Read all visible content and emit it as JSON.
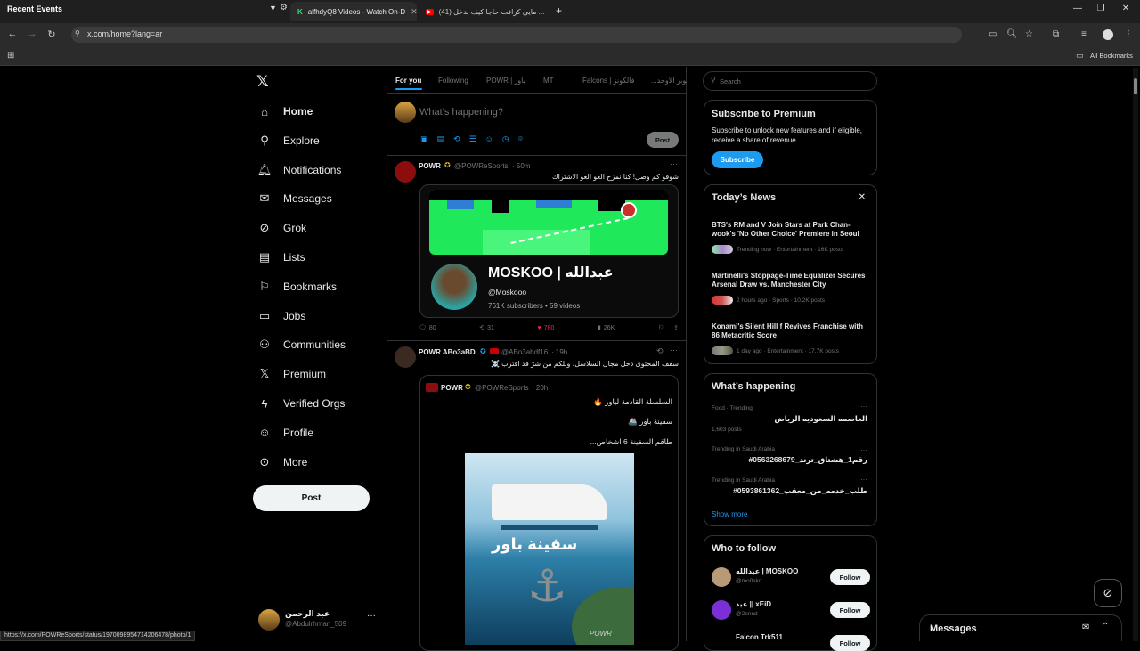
{
  "browser": {
    "window_label": "Recent Events",
    "tabs": [
      {
        "title": "alfhdyQ8 Videos - Watch On-D",
        "active": true
      },
      {
        "title": "(41) مايي كرافت حاجا كيف ندخل ...",
        "active": false
      }
    ],
    "url": "x.com/home?lang=ar",
    "all_bookmarks": "All Bookmarks",
    "status_url": "https://x.com/POWReSports/status/1970098954714206478/photo/1"
  },
  "sidebar": {
    "items": [
      {
        "label": "Home",
        "icon": "home-icon"
      },
      {
        "label": "Explore",
        "icon": "search-icon"
      },
      {
        "label": "Notifications",
        "icon": "bell-icon"
      },
      {
        "label": "Messages",
        "icon": "mail-icon"
      },
      {
        "label": "Grok",
        "icon": "grok-icon"
      },
      {
        "label": "Lists",
        "icon": "list-icon"
      },
      {
        "label": "Bookmarks",
        "icon": "bookmark-icon"
      },
      {
        "label": "Jobs",
        "icon": "briefcase-icon"
      },
      {
        "label": "Communities",
        "icon": "people-icon"
      },
      {
        "label": "Premium",
        "icon": "x-logo-icon"
      },
      {
        "label": "Verified Orgs",
        "icon": "lightning-icon"
      },
      {
        "label": "Profile",
        "icon": "person-icon"
      },
      {
        "label": "More",
        "icon": "more-circle-icon"
      }
    ],
    "post_label": "Post",
    "account_name": "عبد الرحمن",
    "account_handle": "@Abdulrhman_509"
  },
  "feed": {
    "tabs": [
      "For you",
      "Following",
      "POWR | باور",
      "MT",
      "Falcons | فالكونز",
      "...بوبر الأوحد"
    ],
    "compose_placeholder": "What’s happening?",
    "compose_post": "Post",
    "tweet1": {
      "name": "POWR",
      "handle": "@POWReSports",
      "time": "· 50m",
      "text": "شوفو كم وصل! كنا نمزح الغو الغو الاشتراك",
      "card_title": "MOSKOO | عبدالله",
      "card_handle": "@Moskooo",
      "card_meta": "761K subscribers • 59 videos",
      "replies": "80",
      "reposts": "31",
      "likes": "780",
      "views": "26K"
    },
    "tweet2": {
      "name": "POWR ABo3aBD",
      "handle": "@ABo3abdf16",
      "time": "· 19h",
      "text": "سقف المحتوى دخل مجال السلاسل، وبلكم من شرٌ قد اقترب ☠️",
      "quote_name": "POWR",
      "quote_handle": "@POWReSports",
      "quote_time": "· 20h",
      "quote_line1": "السلسلة القادمة لباور 🔥",
      "quote_line2": "سفينة باور 🚢",
      "quote_line3": "طاقم السفينة 6 اشخاص...",
      "poster_title": "سفينة باور",
      "poster_brand": "POWR"
    }
  },
  "right": {
    "search_placeholder": "Search",
    "premium": {
      "title": "Subscribe to Premium",
      "text": "Subscribe to unlock new features and if eligible, receive a share of revenue.",
      "button": "Subscribe"
    },
    "news": {
      "title": "Today’s News",
      "items": [
        {
          "headline": "BTS's RM and V Join Stars at Park Chan-wook's 'No Other Choice' Premiere in Seoul",
          "meta": "Trending now · Entertainment · 16K posts"
        },
        {
          "headline": "Martinelli's Stoppage-Time Equalizer Secures Arsenal Draw vs. Manchester City",
          "meta": "2 hours ago · Sports · 10.2K posts"
        },
        {
          "headline": "Konami's Silent Hill f Revives Franchise with 86 Metacritic Score",
          "meta": "1 day ago · Entertainment · 17.7K posts"
        }
      ]
    },
    "happening": {
      "title": "What’s happening",
      "items": [
        {
          "context": "Food · Trending",
          "topic": "العاصمه السعوديه الرياض",
          "count": "1,603 posts"
        },
        {
          "context": "Trending in Saudi Arabia",
          "topic": "#رقم1_هشتاق_ترند_0563268679",
          "count": ""
        },
        {
          "context": "Trending in Saudi Arabia",
          "topic": "#طلب_خدمه_من_معقب_0593861362",
          "count": ""
        }
      ],
      "show_more": "Show more"
    },
    "follow": {
      "title": "Who to follow",
      "items": [
        {
          "name": "عبدالله | MOSKOO",
          "handle": "@mo0sko",
          "button": "Follow"
        },
        {
          "name": "عيد || xEiD",
          "handle": "@2ennd",
          "button": "Follow"
        },
        {
          "name": "Falcon Trk511",
          "handle": "",
          "button": "Follow"
        }
      ]
    },
    "messages_label": "Messages"
  },
  "colors": {
    "accent": "#1d9bf0",
    "like": "#f91880",
    "gold": "#e2b719"
  }
}
